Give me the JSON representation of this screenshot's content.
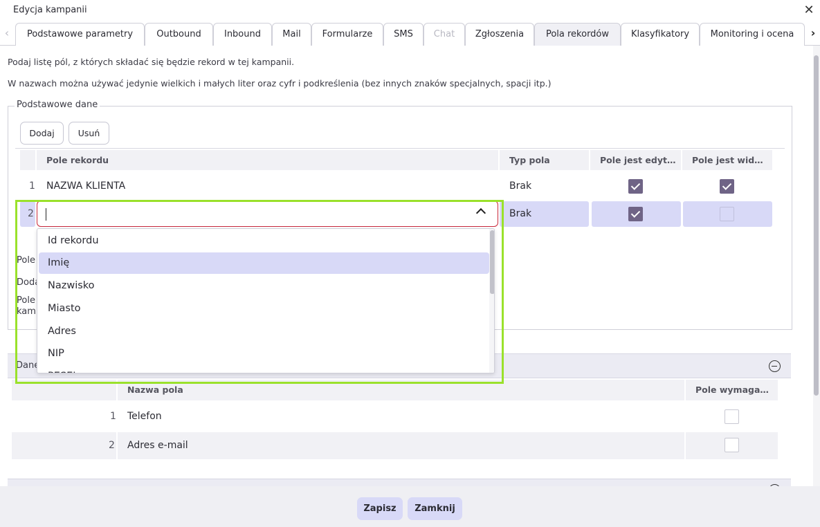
{
  "window": {
    "title": "Edycja kampanii",
    "close_icon": "close-icon"
  },
  "tabs": [
    {
      "label": "Podstawowe parametry",
      "state": "normal"
    },
    {
      "label": "Outbound",
      "state": "normal"
    },
    {
      "label": "Inbound",
      "state": "normal"
    },
    {
      "label": "Mail",
      "state": "normal"
    },
    {
      "label": "Formularze",
      "state": "normal"
    },
    {
      "label": "SMS",
      "state": "normal"
    },
    {
      "label": "Chat",
      "state": "disabled"
    },
    {
      "label": "Zgłoszenia",
      "state": "normal"
    },
    {
      "label": "Pola rekordów",
      "state": "active"
    },
    {
      "label": "Klasyfikatory",
      "state": "normal"
    },
    {
      "label": "Monitoring i ocena",
      "state": "normal"
    }
  ],
  "description": {
    "line1": "Podaj listę pól, z których składać się będzie rekord w tej kampanii.",
    "line2": "W nazwach można używać jedynie wielkich i małych liter oraz cyfr i podkreślenia (bez innych znaków specjalnych, spacji itp.)"
  },
  "basic_section": {
    "legend": "Podstawowe dane",
    "add_label": "Dodaj",
    "remove_label": "Usuń",
    "columns": [
      "Pole rekordu",
      "Typ pola",
      "Pole jest edyt…",
      "Pole jest wid…"
    ],
    "rows": [
      {
        "num": "1",
        "field": "NAZWA KLIENTA",
        "type": "Brak",
        "editable": true,
        "visible": true
      },
      {
        "num": "2",
        "field": "",
        "type": "Brak",
        "editable": true,
        "visible": false
      }
    ],
    "dropdown_options": [
      "Id rekordu",
      "Imię",
      "Nazwisko",
      "Miasto",
      "Adres",
      "NIP",
      "PESEL"
    ],
    "dropdown_highlighted": "Imię",
    "hidden_labels": [
      "Pole",
      "Doda",
      "Pole",
      "kam"
    ]
  },
  "contact_section": {
    "title": "Dane",
    "columns": [
      "Nazwa pola",
      "Pole wymaga…"
    ],
    "rows": [
      {
        "num": "1",
        "name": "Telefon",
        "required": false
      },
      {
        "num": "2",
        "name": "Adres e-mail",
        "required": false
      }
    ]
  },
  "footer": {
    "save_label": "Zapisz",
    "close_label": "Zamknij"
  },
  "colors": {
    "accent": "#6f6486",
    "selection": "#d8d9f7",
    "highlight_box": "#9ae12b",
    "error_border": "#c8273a"
  }
}
